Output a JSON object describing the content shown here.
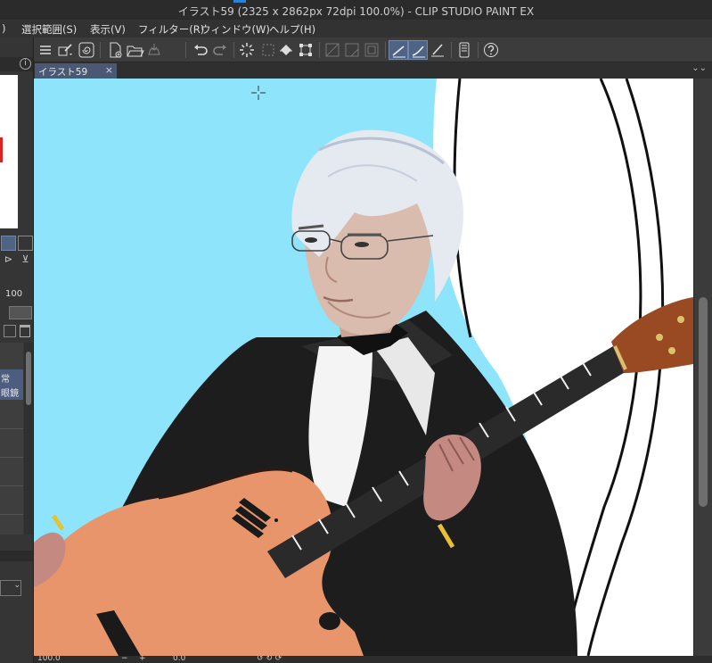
{
  "window": {
    "title": "イラスト59 (2325 x 2862px 72dpi 100.0%)  - CLIP STUDIO PAINT EX",
    "accent_color": "#2f80d8"
  },
  "menu": {
    "items": [
      {
        "label": ")"
      },
      {
        "label": "選択範囲(S)"
      },
      {
        "label": "表示(V)"
      },
      {
        "label": "フィルター(R)"
      },
      {
        "label": "ウィンドウ(W)"
      },
      {
        "label": "ヘルプ(H)"
      }
    ]
  },
  "document_tab": {
    "label": "イラスト59",
    "close_glyph": "×",
    "menu_glyph": "⌄⌄"
  },
  "left_panel": {
    "info_glyph": "i",
    "opacity_value": "100",
    "layer_labels": [
      "常",
      "眼鏡"
    ]
  },
  "status": {
    "zoom": "100.0",
    "minus": "−",
    "plus": "+",
    "angle": "0.0"
  },
  "colors": {
    "canvas_bg": "#8ee5fb",
    "ui_dark": "#3a3a3a",
    "selected_tool": "#4f6485"
  }
}
